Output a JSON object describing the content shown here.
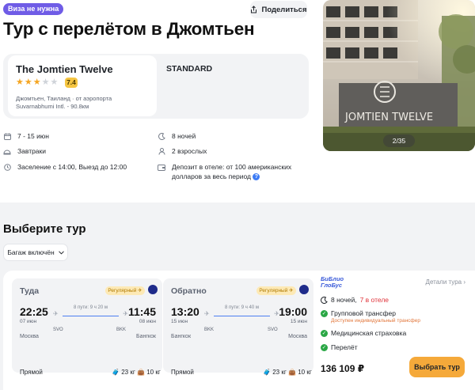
{
  "header": {
    "visa_badge": "Виза не нужна",
    "share_label": "Поделиться",
    "title": "Тур с перелётом в Джомтьен"
  },
  "hotel": {
    "name": "The Jomtien Twelve",
    "stars": 3,
    "stars_max": 5,
    "rating": "7.4",
    "location_line1": "Джомтьен, Таиланд · от аэропорта",
    "location_line2": "Suvarnabhumi Intl. - 90.8км",
    "room_type": "STANDARD"
  },
  "details": {
    "dates": "7 - 15 июн",
    "nights": "8 ночей",
    "meals": "Завтраки",
    "guests": "2 взрослых",
    "checkin": "Заселение с 14:00, Выезд до 12:00",
    "deposit_line1": "Депозит в отеле: от 100 американских",
    "deposit_line2": "долларов за весь период"
  },
  "gallery": {
    "counter": "2/35",
    "sign_text": "JOMTIEN TWELVE"
  },
  "tours": {
    "title": "Выберите тур",
    "filter_label": "Багаж включён"
  },
  "offer": {
    "outbound": {
      "label": "Туда",
      "badge": "Регулярный",
      "duration": "8 пути: 9 ч 20 м",
      "dep_time": "22:25",
      "dep_date": "07 июн",
      "dep_code": "SVO",
      "dep_city": "Москва",
      "arr_time": "11:45",
      "arr_date": "08 июн",
      "arr_code": "BKK",
      "arr_city": "Бангкок",
      "type": "Прямой",
      "bag": "23 кг",
      "hand": "10 кг"
    },
    "inbound": {
      "label": "Обратно",
      "badge": "Регулярный",
      "duration": "8 пути: 9 ч 40 м",
      "dep_time": "13:20",
      "dep_date": "15 июн",
      "dep_code": "BKK",
      "dep_city": "Бангкок",
      "arr_time": "19:00",
      "arr_date": "15 июн",
      "arr_code": "SVO",
      "arr_city": "Москва",
      "type": "Прямой",
      "bag": "23 кг",
      "hand": "10 кг"
    },
    "operator_line1": "БиБлио",
    "operator_line2": "ГлоБус",
    "details_link": "Детали тура",
    "nights": "8 ночей,",
    "nights_hotel": "7 в отеле",
    "transfer": "Групповой трансфер",
    "transfer_sub": "Доступен индивидуальный трансфер",
    "insurance": "Медицинская страховка",
    "flight": "Перелёт",
    "price": "136 109 ₽",
    "buy_label": "Выбрать тур"
  }
}
